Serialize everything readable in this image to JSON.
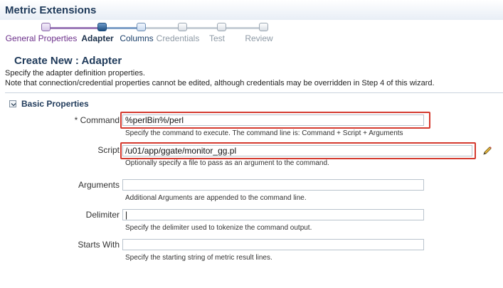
{
  "app": {
    "title": "Metric Extensions"
  },
  "train": {
    "steps": [
      {
        "label": "General Properties",
        "state": "visited"
      },
      {
        "label": "Adapter",
        "state": "current"
      },
      {
        "label": "Columns",
        "state": "next"
      },
      {
        "label": "Credentials",
        "state": "disabled"
      },
      {
        "label": "Test",
        "state": "disabled"
      },
      {
        "label": "Review",
        "state": "disabled"
      }
    ]
  },
  "page": {
    "title": "Create New : Adapter",
    "description1": "Specify the adapter definition properties.",
    "description2": "Note that connection/credential properties cannot be edited, although credentials may be overridden in Step 4 of this wizard."
  },
  "section": {
    "title": "Basic Properties"
  },
  "fields": {
    "command": {
      "required_mark": "*",
      "label": "Command",
      "value": "%perlBin%/perl",
      "hint": "Specify the command to execute. The command line is: Command + Script + Arguments"
    },
    "script": {
      "label": "Script",
      "value": "/u01/app/ggate/monitor_gg.pl",
      "hint": "Optionally specify a file to pass as an argument to the command."
    },
    "arguments": {
      "label": "Arguments",
      "value": "",
      "hint": "Additional Arguments are appended to the command line."
    },
    "delimiter": {
      "label": "Delimiter",
      "value": "|",
      "hint": "Specify the delimiter used to tokenize the command output."
    },
    "starts_with": {
      "label": "Starts With",
      "value": "",
      "hint": "Specify the starting string of metric result lines."
    }
  },
  "colors": {
    "accent": "#1f3a5a",
    "highlight": "#d43a2f"
  }
}
